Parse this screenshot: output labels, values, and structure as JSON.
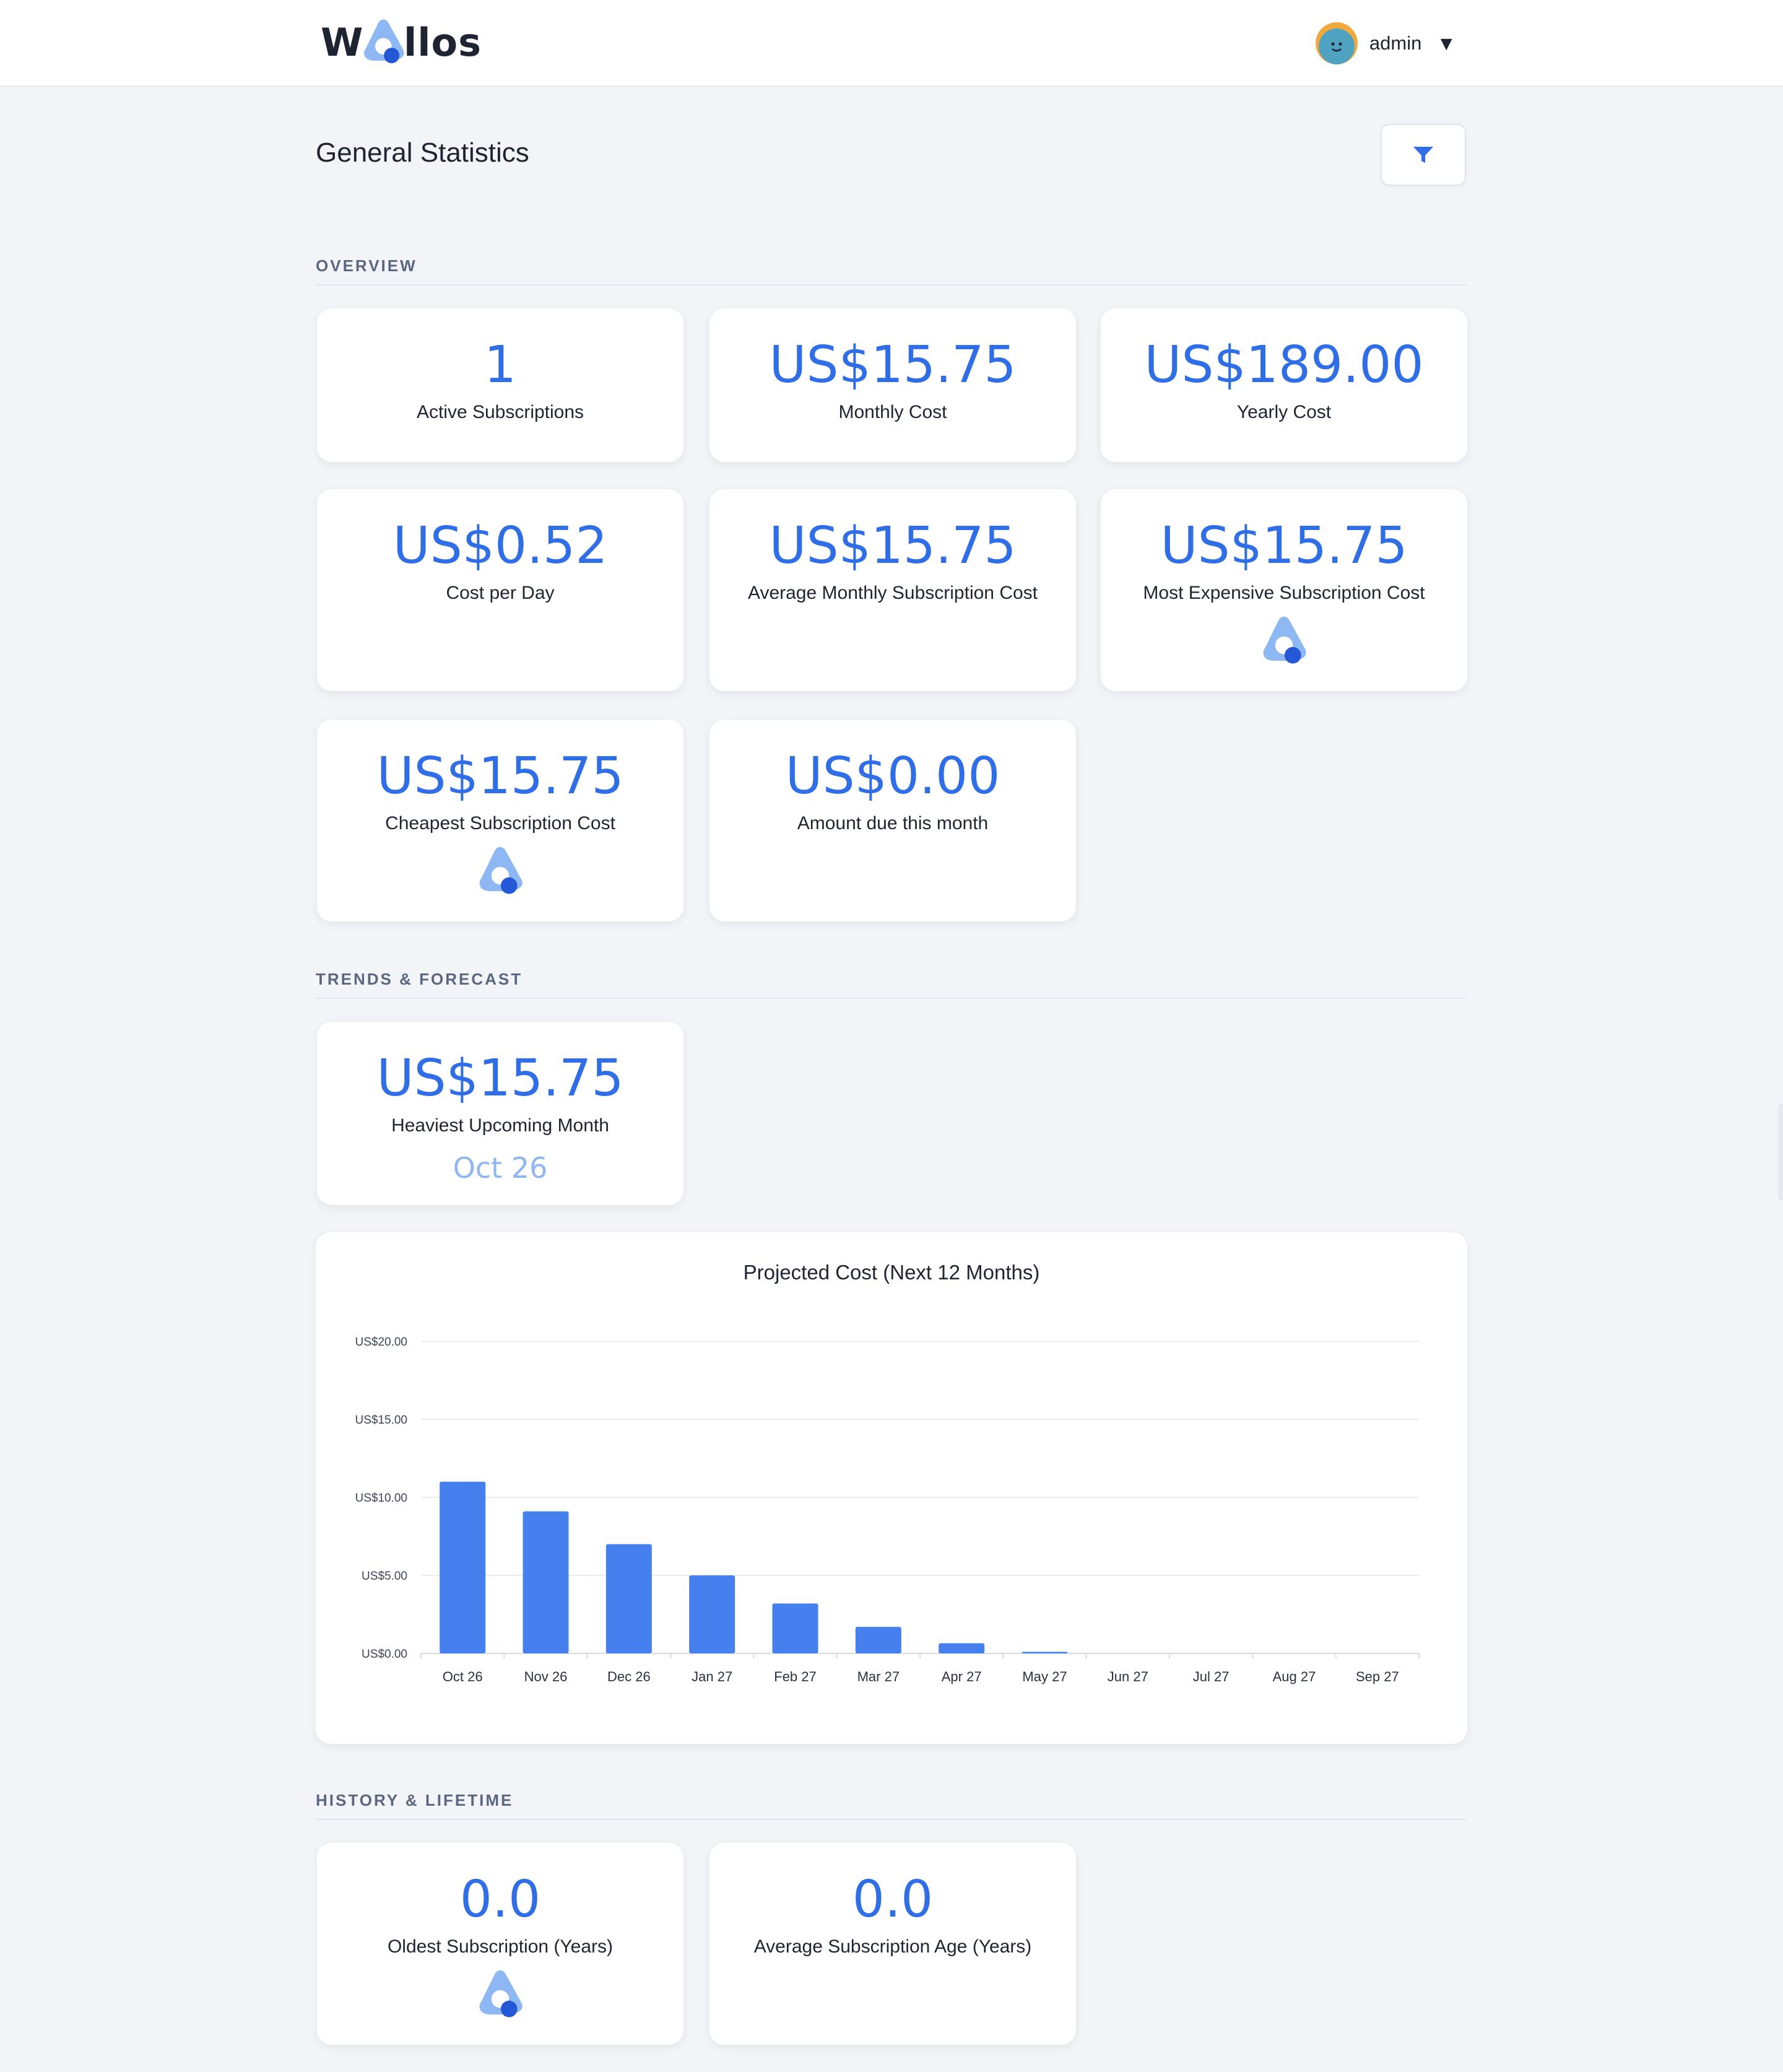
{
  "app": {
    "logo_left": "W",
    "logo_right": "llos",
    "username": "admin"
  },
  "colors": {
    "accent": "#2f6ee6",
    "bar": "#4680ee",
    "muted_accent": "#8db6f2",
    "background": "#f3f4f7"
  },
  "page": {
    "title": "General Statistics",
    "filter_icon": "filter-icon"
  },
  "sections": {
    "overview": "OVERVIEW",
    "trends": "TRENDS & FORECAST",
    "history": "HISTORY & LIFETIME"
  },
  "overview_cards": [
    {
      "value": "1",
      "label": "Active Subscriptions"
    },
    {
      "value": "US$15.75",
      "label": "Monthly Cost"
    },
    {
      "value": "US$189.00",
      "label": "Yearly Cost"
    },
    {
      "value": "US$0.52",
      "label": "Cost per Day"
    },
    {
      "value": "US$15.75",
      "label": "Average Monthly Subscription Cost"
    },
    {
      "value": "US$15.75",
      "label": "Most Expensive Subscription Cost",
      "icon": "wallos-logo-icon"
    },
    {
      "value": "US$15.75",
      "label": "Cheapest Subscription Cost",
      "icon": "wallos-logo-icon"
    },
    {
      "value": "US$0.00",
      "label": "Amount due this month"
    }
  ],
  "trend_cards": [
    {
      "value": "US$15.75",
      "label": "Heaviest Upcoming Month",
      "sub": "Oct 26"
    }
  ],
  "history_cards": [
    {
      "value": "0.0",
      "label": "Oldest Subscription (Years)",
      "icon": "wallos-logo-icon"
    },
    {
      "value": "0.0",
      "label": "Average Subscription Age (Years)"
    }
  ],
  "chart_data": {
    "type": "bar",
    "title": "Projected Cost (Next 12 Months)",
    "xlabel": "",
    "ylabel": "",
    "categories": [
      "Oct 26",
      "Nov 26",
      "Dec 26",
      "Jan 27",
      "Feb 27",
      "Mar 27",
      "Apr 27",
      "May 27",
      "Jun 27",
      "Jul 27",
      "Aug 27",
      "Sep 27"
    ],
    "values": [
      11.0,
      9.1,
      7.0,
      5.0,
      3.2,
      1.7,
      0.65,
      0.1,
      0,
      0,
      0,
      0
    ],
    "ylim": [
      0,
      20
    ],
    "yticks": [
      "US$0.00",
      "US$5.00",
      "US$10.00",
      "US$15.00",
      "US$20.00"
    ],
    "ytick_values": [
      0,
      5,
      10,
      15,
      20
    ],
    "grid": true,
    "legend": "none"
  }
}
